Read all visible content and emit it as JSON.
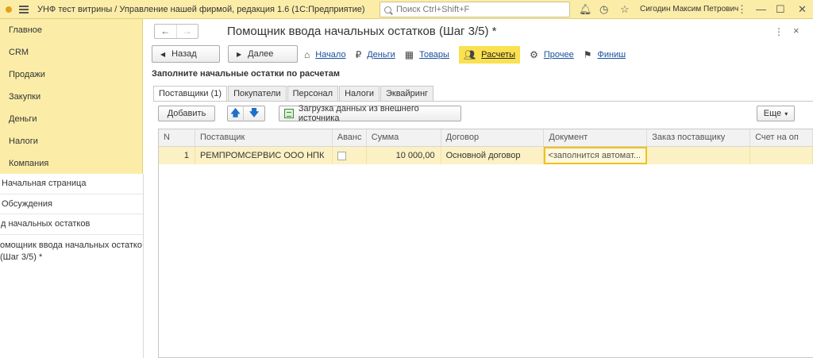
{
  "app": {
    "title": "УНФ тест витрины / Управление нашей фирмой, редакция 1.6  (1С:Предприятие)",
    "search_placeholder": "Поиск Ctrl+Shift+F",
    "user": "Сигодин Максим Петрович"
  },
  "sidebar": {
    "items": [
      "Главное",
      "CRM",
      "Продажи",
      "Закупки",
      "Деньги",
      "Налоги",
      "Компания"
    ]
  },
  "open_windows": [
    "Начальная страница",
    "Обсуждения",
    "д начальных остатков",
    "омощник ввода начальных остатко (Шаг 3/5) *"
  ],
  "form": {
    "title": "Помощник ввода начальных остатков (Шаг 3/5) *",
    "back_label": "Назад",
    "next_label": "Далее",
    "steps": [
      "Начало",
      "Деньги",
      "Товары",
      "Расчеты",
      "Прочее",
      "Финиш"
    ],
    "section_title": "Заполните начальные остатки по расчетам",
    "tabs": [
      "Поставщики (1)",
      "Покупатели",
      "Персонал",
      "Налоги",
      "Эквайринг"
    ],
    "add_label": "Добавить",
    "import_label": "Загрузка данных из внешнего источника",
    "more_label": "Еще"
  },
  "table": {
    "columns": [
      "N",
      "Поставщик",
      "Аванс",
      "Сумма",
      "Договор",
      "Документ",
      "Заказ поставщику",
      "Счет на оп"
    ],
    "rows": [
      {
        "n": "1",
        "supplier": "РЕМПРОМСЕРВИС ООО НПК",
        "advance": false,
        "sum": "10 000,00",
        "contract": "Основной договор",
        "document": "<заполнится автомат...",
        "order": "",
        "invoice": ""
      }
    ]
  }
}
